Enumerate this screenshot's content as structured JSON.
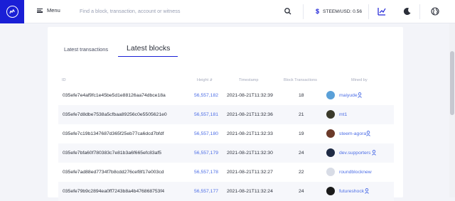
{
  "header": {
    "menu_label": "Menu",
    "search_placeholder": "Find a block, transaction, account or witness",
    "price_label": "STEEM/USD: 0.56",
    "icons": [
      "search-icon",
      "dollar-icon",
      "chart-icon",
      "moon-icon",
      "globe-icon"
    ]
  },
  "tabs": [
    {
      "label": "Latest transactions"
    },
    {
      "label": "Latest blocks"
    }
  ],
  "table": {
    "headers": {
      "id": "ID",
      "height": "Height",
      "timestamp": "Timestamp",
      "tx": "Block Transactions",
      "miner": "Mined by"
    },
    "rows": [
      {
        "id": "035efe7e4af9fc1e45be5d1e88126aa74dbce18a",
        "height": "56,557,182",
        "time": "2021-08-21T11:32:39",
        "tx": "18",
        "miner": "maiyude",
        "avatar": "#5aa0d8"
      },
      {
        "id": "035efe7d8dbe7538a5cfbaa89256c0e5505621e0",
        "height": "56,557,181",
        "time": "2021-08-21T11:32:36",
        "tx": "21",
        "miner": "mt1",
        "avatar": "#3a3a2a"
      },
      {
        "id": "035efe7c19b1347687d365f25eb77ca6dcd7bfdf",
        "height": "56,557,180",
        "time": "2021-08-21T11:32:33",
        "tx": "19",
        "miner": "steem-agora",
        "avatar": "#6b3a2a"
      },
      {
        "id": "035efe7bfa60f780383c7e81b3a6f665efc83af5",
        "height": "56,557,179",
        "time": "2021-08-21T11:32:30",
        "tx": "24",
        "miner": "dev.supporters",
        "avatar": "#1e2a44"
      },
      {
        "id": "035efe7ad88ed7734f7b8cdd276cef8f17e003cd",
        "height": "56,557,178",
        "time": "2021-08-21T11:32:27",
        "tx": "22",
        "miner": "roundblocknew",
        "avatar": "#d8dce6"
      },
      {
        "id": "035efe79b9c2894ea0ff7243b8a4b476868753f4",
        "height": "56,557,177",
        "time": "2021-08-21T11:32:24",
        "tx": "24",
        "miner": "futureshock",
        "avatar": "#1a1a1a"
      }
    ]
  },
  "colors": {
    "brand": "#1a1fd6",
    "link": "#4d6ee6"
  }
}
